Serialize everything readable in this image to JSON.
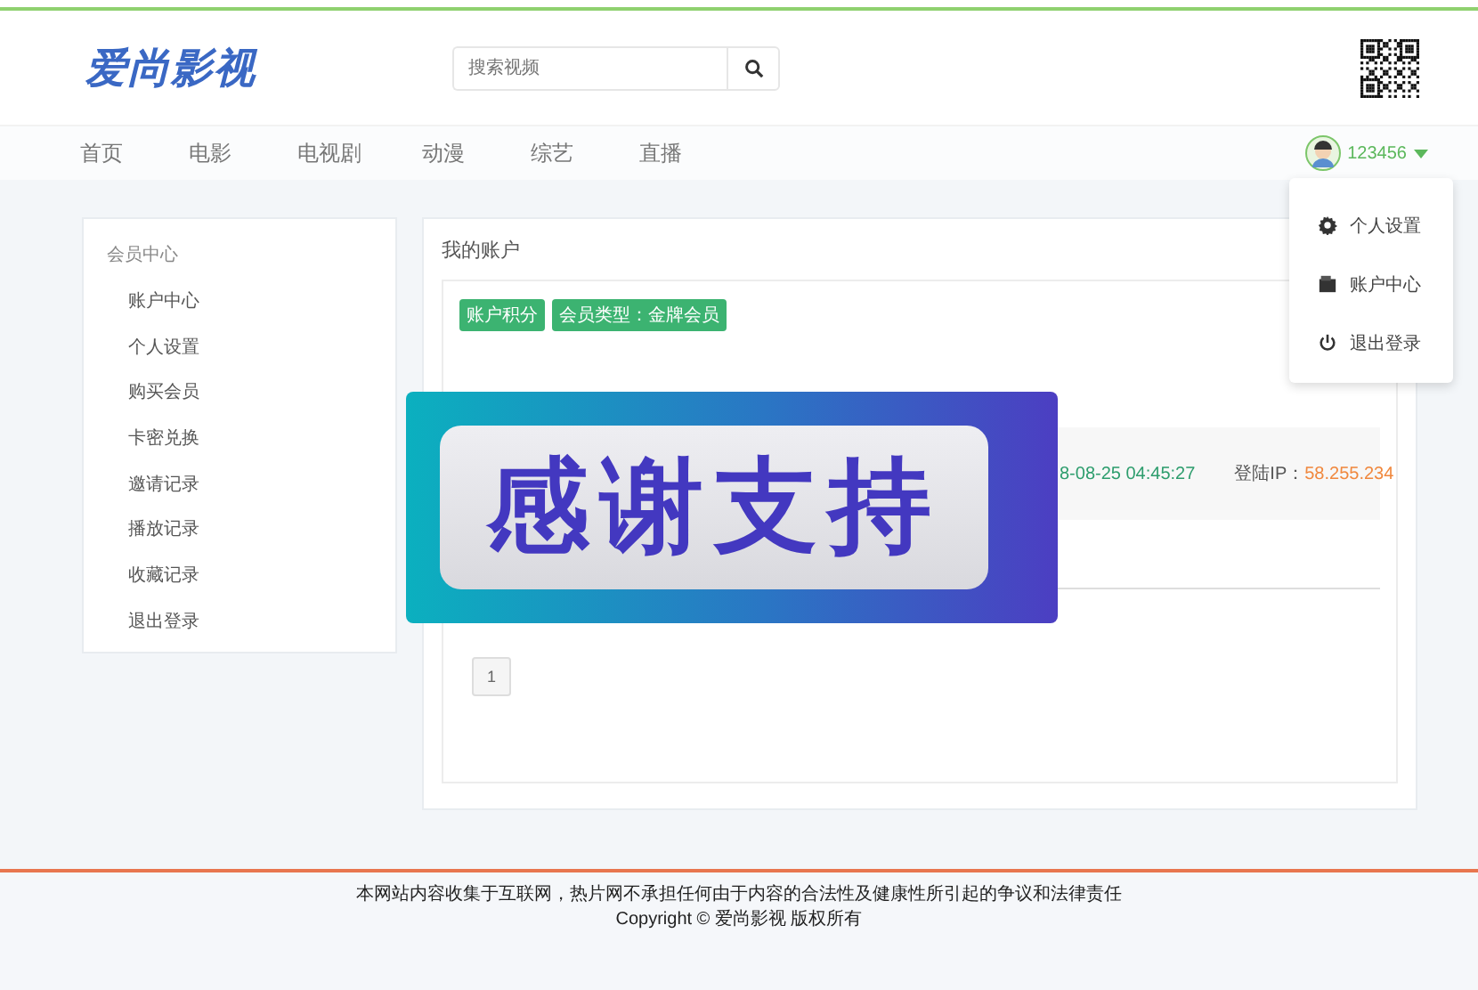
{
  "header": {
    "logo": "爱尚影视",
    "search": {
      "placeholder": "搜索视频"
    }
  },
  "nav": {
    "items": [
      "首页",
      "电影",
      "电视剧",
      "动漫",
      "综艺",
      "直播"
    ],
    "user": {
      "name": "123456"
    }
  },
  "user_menu": [
    {
      "kind": "settings",
      "label": "个人设置"
    },
    {
      "kind": "account",
      "label": "账户中心"
    },
    {
      "kind": "logout",
      "label": "退出登录"
    }
  ],
  "sidebar": {
    "title": "会员中心",
    "items": [
      "账户中心",
      "个人设置",
      "购买会员",
      "卡密兑换",
      "邀请记录",
      "播放记录",
      "收藏记录",
      "退出登录"
    ]
  },
  "account": {
    "title": "我的账户",
    "tags": [
      "账户积分",
      "会员类型：金牌会员"
    ],
    "login_time": "8-08-25 04:45:27",
    "ip_label": "登陆IP：",
    "ip": "58.255.234",
    "pages": [
      "1"
    ]
  },
  "banner": {
    "text": "感谢支持"
  },
  "footer": [
    "本网站内容收集于互联网，热片网不承担任何由于内容的合法性及健康性所引起的争议和法律责任",
    "Copyright ©  爱尚影视 版权所有"
  ]
}
